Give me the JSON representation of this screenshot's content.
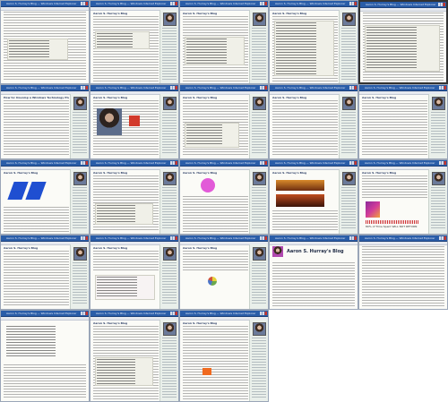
{
  "page": {
    "title": "Aaron S. Hurray's Blog",
    "window_title": "Aaron S. Hurray's Blog — Windows Internet Explorer"
  },
  "windows": [
    {
      "post_title": "Aaron S. Hurray's Blog"
    },
    {
      "post_title": "Aaron S. Hurray's Blog"
    },
    {
      "post_title": "Aaron S. Hurray's Blog"
    },
    {
      "post_title": "Aaron S. Hurray's Blog"
    },
    {
      "post_title": "Aaron S. Hurray's Blog"
    },
    {
      "post_title": "How to: Develop a Windows Technology Plugin"
    },
    {
      "post_title": "Aaron S. Hurray's Blog"
    },
    {
      "post_title": "Aaron S. Hurray's Blog"
    },
    {
      "post_title": "Aaron S. Hurray's Blog"
    },
    {
      "post_title": "Aaron S. Hurray's Blog"
    },
    {
      "post_title": "Aaron S. Hurray's Blog"
    },
    {
      "post_title": "Aaron S. Hurray's Blog"
    },
    {
      "post_title": "Aaron S. Hurray's Blog"
    },
    {
      "post_title": "Aaron S. Hurray's Blog"
    },
    {
      "post_title": "Aaron S. Hurray's Blog"
    },
    {
      "post_title": "Aaron S. Hurray's Blog"
    },
    {
      "post_title": "Aaron S. Hurray's Blog"
    },
    {
      "post_title": "Aaron S. Hurray's Blog"
    },
    {
      "post_title": "Aaron S. Hurray's Blog"
    },
    {
      "post_title": "Aaron S. Hurray's Blog"
    },
    {
      "post_title": "Aaron S. Hurray's Blog"
    },
    {
      "post_title": "Aaron S. Hurray's Blog"
    },
    {
      "post_title": "Aaron S. Hurray's Blog"
    }
  ],
  "center_window": {
    "heading": "Aaron S. Hurray's Blog"
  },
  "right_promo": {
    "text": "80% of Time Spent WILL NOT RETURN"
  },
  "colors": {
    "titlebar": "#2a5da8",
    "sidebar": "#e9efea",
    "accent_blue": "#1f4fd1",
    "accent_pink": "#e25ad8",
    "accent_orange": "#f06a1f"
  },
  "icons": [
    "avatar-icon",
    "close-icon",
    "minimize-icon",
    "maximize-icon"
  ]
}
